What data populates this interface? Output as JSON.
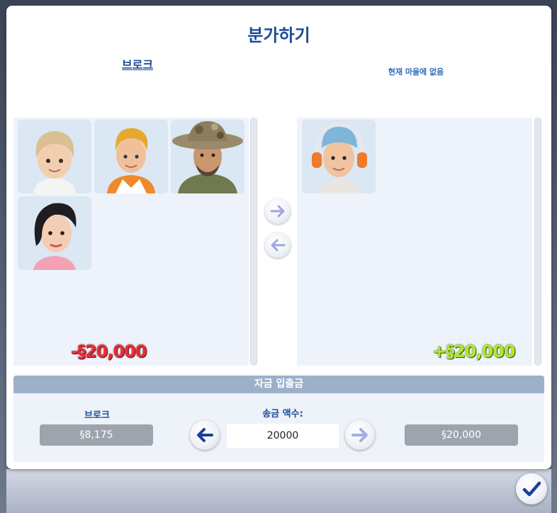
{
  "dialog": {
    "title": "분가하기",
    "left_household": "브로크",
    "right_household": "현재 마을에 없음"
  },
  "left_panel": {
    "sims": [
      {
        "icon": "sim-portrait-toddler"
      },
      {
        "icon": "sim-portrait-child"
      },
      {
        "icon": "sim-portrait-adult-hat"
      },
      {
        "icon": "sim-portrait-young-woman"
      }
    ],
    "funds_change": "-§20,000"
  },
  "right_panel": {
    "sims": [
      {
        "icon": "sim-portrait-young-man-headphones"
      }
    ],
    "funds_change": "+§20,000"
  },
  "transfer": {
    "header": "자금 입출금",
    "left_label": "브로크",
    "left_funds": "§8,175",
    "amount_label": "송금 액수:",
    "amount_value": "20000",
    "right_funds": "§20,000"
  },
  "colors": {
    "title_blue": "#1b4c9a",
    "negative": "#e0303a",
    "positive": "#b4e632",
    "header_bar": "#9cb0ca"
  }
}
